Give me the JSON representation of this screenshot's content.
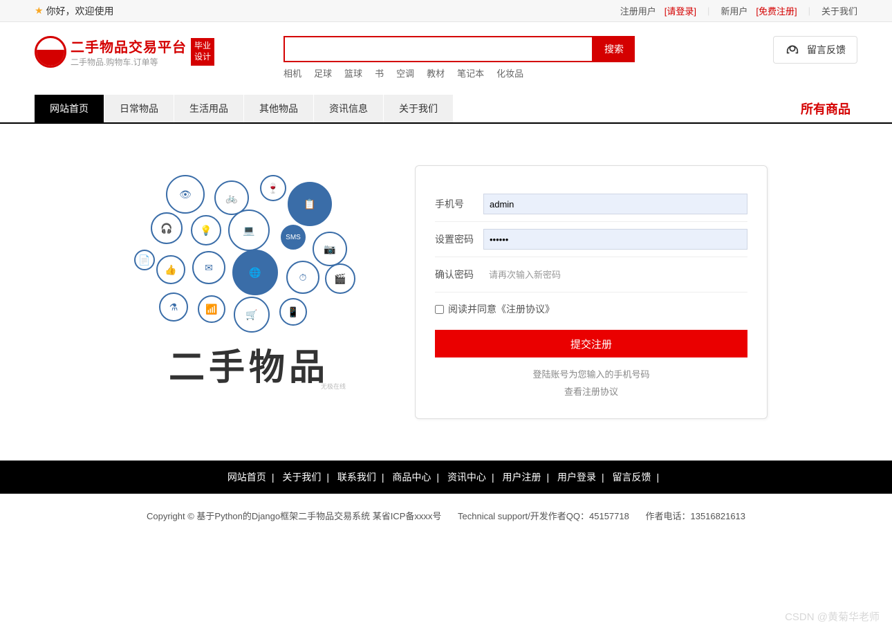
{
  "topbar": {
    "welcome": "你好，欢迎使用",
    "registered_user": "注册用户",
    "login": "[请登录]",
    "new_user": "新用户",
    "register_free": "[免费注册]",
    "about": "关于我们"
  },
  "header": {
    "title": "二手物品交易平台",
    "subtitle": "二手物品.购物车.订单等",
    "badge_line1": "毕业",
    "badge_line2": "设计",
    "search_button": "搜索",
    "search_value": "",
    "tags": [
      "相机",
      "足球",
      "篮球",
      "书",
      "空调",
      "教材",
      "笔记本",
      "化妆品"
    ],
    "feedback": "留言反馈"
  },
  "nav": {
    "items": [
      "网站首页",
      "日常物品",
      "生活用品",
      "其他物品",
      "资讯信息",
      "关于我们"
    ],
    "all_products": "所有商品"
  },
  "promo": {
    "title": "二手物品",
    "watermark": "无极在线"
  },
  "form": {
    "phone_label": "手机号",
    "phone_value": "admin",
    "pwd_label": "设置密码",
    "pwd_value": "••••••",
    "confirm_label": "确认密码",
    "confirm_placeholder": "请再次输入新密码",
    "agree_text": "阅读并同意《注册协议》",
    "submit": "提交注册",
    "note1": "登陆账号为您输入的手机号码",
    "note2": "查看注册协议"
  },
  "footer": {
    "links": [
      "网站首页",
      "关于我们",
      "联系我们",
      "商品中心",
      "资讯中心",
      "用户注册",
      "用户登录",
      "留言反馈"
    ],
    "copy1": "Copyright © 基于Python的Django框架二手物品交易系统 某省ICP备xxxx号",
    "copy2": "Technical support/开发作者QQ：45157718",
    "copy3": "作者电话：13516821613"
  },
  "watermark": "CSDN @黄菊华老师"
}
